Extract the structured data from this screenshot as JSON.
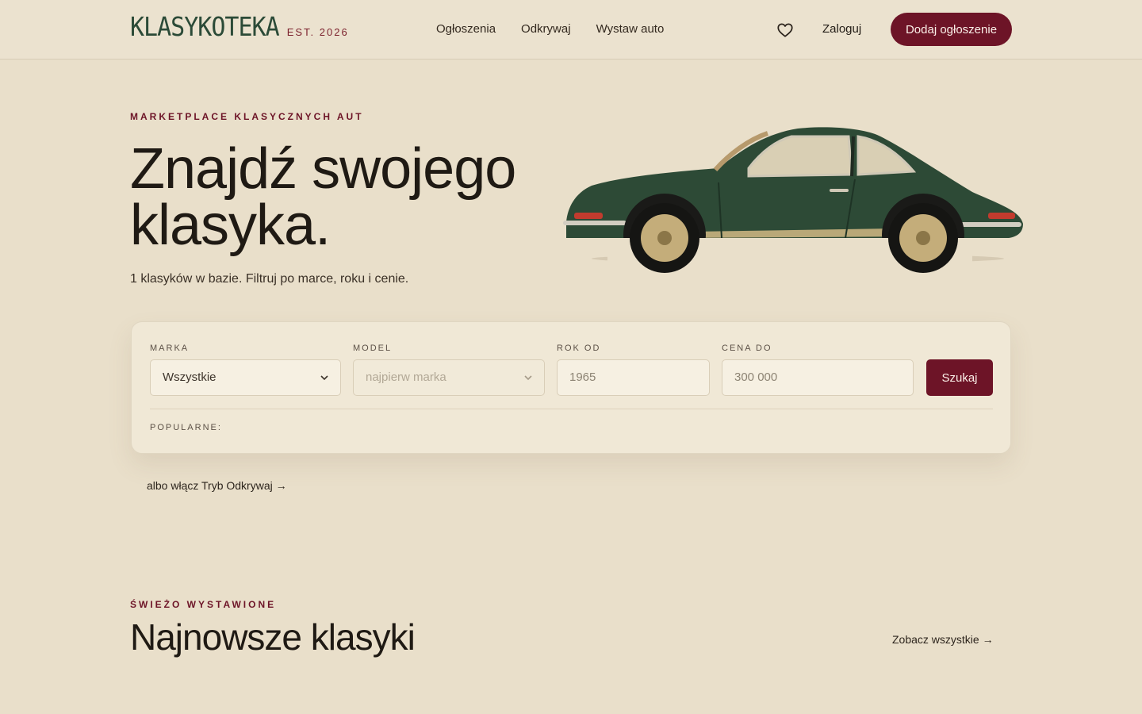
{
  "header": {
    "logo": "KLASYKOTEKA",
    "logo_tag": "EST. 2026",
    "nav": [
      "Ogłoszenia",
      "Odkrywaj",
      "Wystaw auto"
    ],
    "login": "Zaloguj",
    "add_listing": "Dodaj ogłoszenie"
  },
  "hero": {
    "eyebrow": "MARKETPLACE KLASYCZNYCH AUT",
    "title_line1": "Znajdź swojego",
    "title_line2": "klasyka.",
    "subtitle": "1 klasyków w bazie. Filtruj po marce, roku i cenie."
  },
  "search": {
    "make_label": "MARKA",
    "make_value": "Wszystkie",
    "model_label": "MODEL",
    "model_placeholder": "najpierw marka",
    "year_label": "ROK OD",
    "year_placeholder": "1965",
    "price_label": "CENA DO",
    "price_placeholder": "300 000",
    "submit": "Szukaj",
    "popular_label": "POPULARNE:"
  },
  "discover_link": "albo włącz Tryb Odkrywaj →",
  "latest": {
    "eyebrow": "ŚWIEŻO WYSTAWIONE",
    "title": "Najnowsze klasyki",
    "see_all": "Zobacz wszystkie →"
  },
  "colors": {
    "background": "#e9dfca",
    "accent": "#6d1427",
    "logo_green": "#2b4a37",
    "car_green": "#2d4a36"
  },
  "icons": {
    "favorites": "heart-icon",
    "dropdown": "chevron-down-icon"
  }
}
